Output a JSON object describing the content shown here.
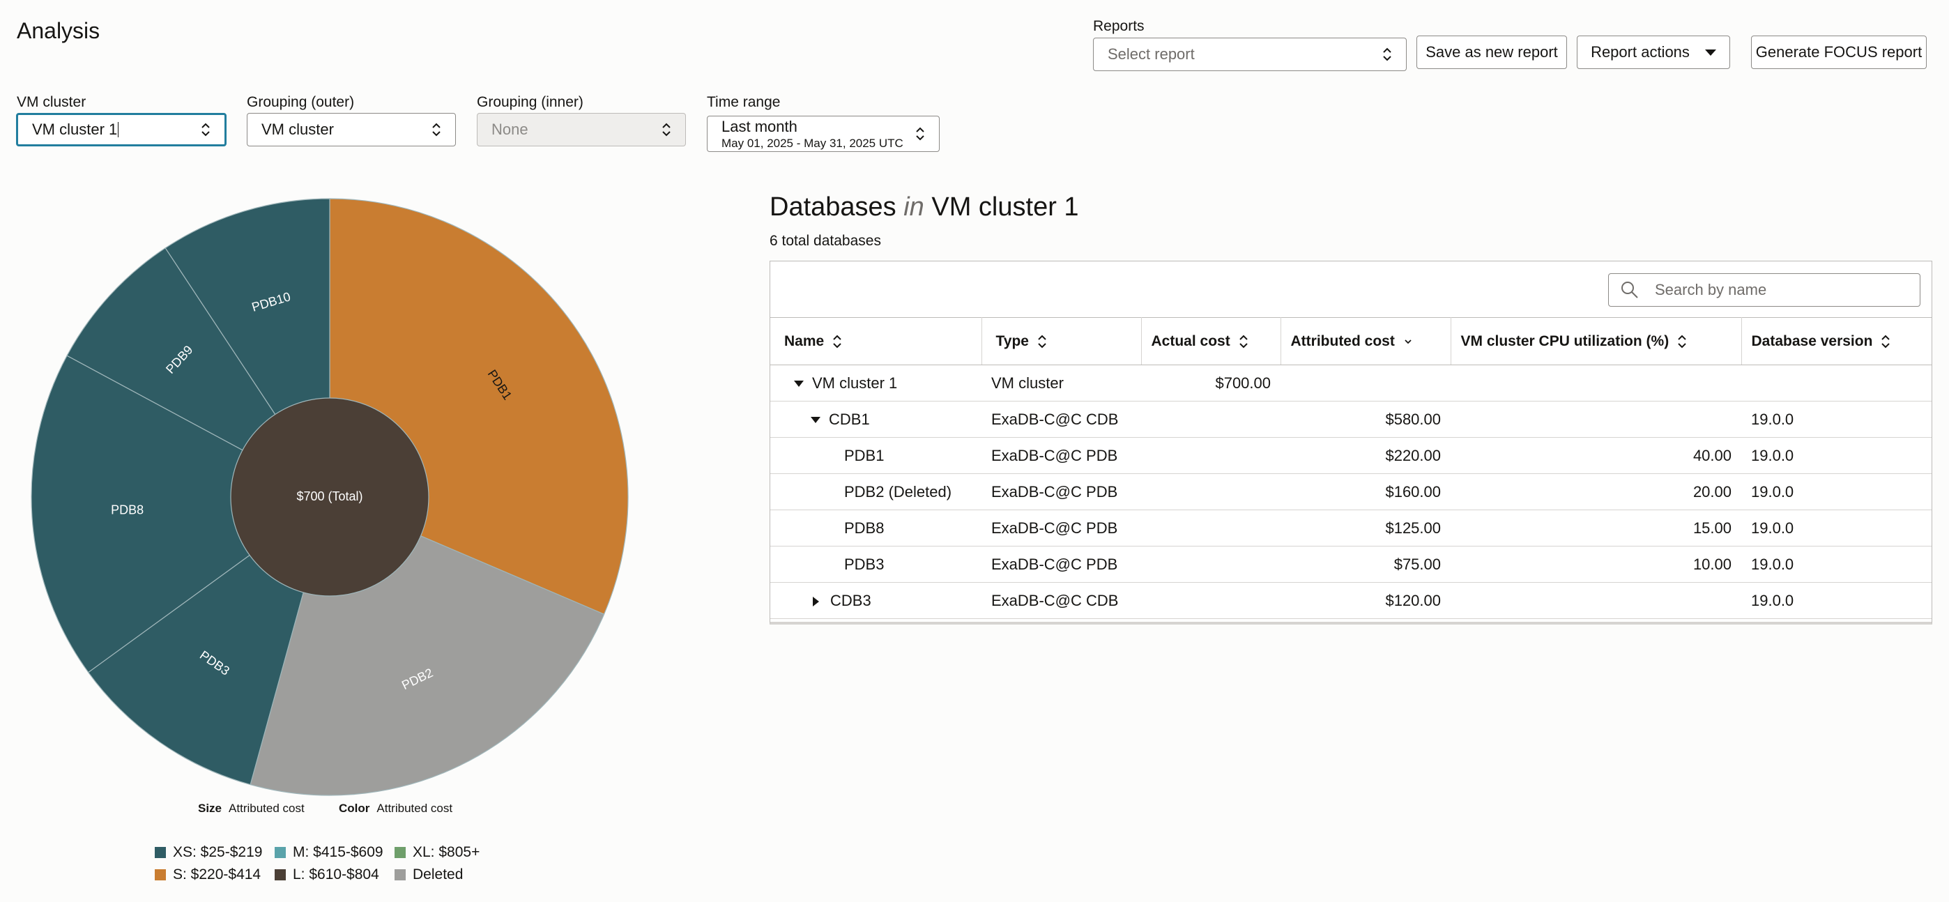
{
  "page": {
    "title": "Analysis"
  },
  "reports": {
    "label": "Reports",
    "select_placeholder": "Select report",
    "save_label": "Save as new report",
    "actions_label": "Report actions",
    "focus_label": "Generate FOCUS report"
  },
  "filters": {
    "vm_cluster": {
      "label": "VM cluster",
      "value": "VM cluster 1"
    },
    "grouping_outer": {
      "label": "Grouping (outer)",
      "value": "VM cluster"
    },
    "grouping_inner": {
      "label": "Grouping (inner)",
      "value": "None"
    },
    "time_range": {
      "label": "Time range",
      "value": "Last month",
      "sub": "May 01, 2025 - May 31, 2025 UTC"
    }
  },
  "chart_data": {
    "type": "pie",
    "center_label": "$700 (Total)",
    "slices": [
      {
        "label": "PDB1",
        "value": 220,
        "color": "#c97d31",
        "label_color": "#161513"
      },
      {
        "label": "PDB2",
        "value": 160,
        "color": "#9e9e9c",
        "label_color": "#ffffff"
      },
      {
        "label": "PDB3",
        "value": 75,
        "color": "#2f5c64",
        "label_color": "#ffffff"
      },
      {
        "label": "PDB8",
        "value": 125,
        "color": "#2f5c64",
        "label_color": "#ffffff"
      },
      {
        "label": "PDB9",
        "value": 55,
        "color": "#2f5c64",
        "label_color": "#ffffff"
      },
      {
        "label": "PDB10",
        "value": 65,
        "color": "#2f5c64",
        "label_color": "#ffffff"
      }
    ],
    "center_color": "#4b3f36",
    "size_caption": {
      "key": "Size",
      "value": "Attributed cost"
    },
    "color_caption": {
      "key": "Color",
      "value": "Attributed cost"
    },
    "legend": [
      {
        "label": "XS: $25-$219",
        "color": "#2f5c64"
      },
      {
        "label": "M: $415-$609",
        "color": "#5aa3aa"
      },
      {
        "label": "XL: $805+",
        "color": "#6f9f6b"
      },
      {
        "label": "S: $220-$414",
        "color": "#c97d31"
      },
      {
        "label": "L: $610-$804",
        "color": "#4b3f36"
      },
      {
        "label": "Deleted",
        "color": "#9e9e9c"
      }
    ]
  },
  "databases": {
    "heading_prefix": "Databases",
    "heading_in": "in",
    "heading_suffix": "VM cluster 1",
    "count": "6 total databases",
    "search_placeholder": "Search by name",
    "columns": [
      "Name",
      "Type",
      "Actual cost",
      "Attributed cost",
      "VM cluster CPU utilization (%)",
      "Database version"
    ],
    "rows": [
      {
        "name": "VM cluster 1",
        "type": "VM cluster",
        "actual": "$700.00",
        "attributed": "",
        "cpu": "",
        "version": ""
      },
      {
        "name": "CDB1",
        "type": "ExaDB-C@C CDB",
        "actual": "",
        "attributed": "$580.00",
        "cpu": "",
        "version": "19.0.0"
      },
      {
        "name": "PDB1",
        "type": "ExaDB-C@C PDB",
        "actual": "",
        "attributed": "$220.00",
        "cpu": "40.00",
        "version": "19.0.0"
      },
      {
        "name": "PDB2 (Deleted)",
        "type": "ExaDB-C@C PDB",
        "actual": "",
        "attributed": "$160.00",
        "cpu": "20.00",
        "version": "19.0.0"
      },
      {
        "name": "PDB8",
        "type": "ExaDB-C@C PDB",
        "actual": "",
        "attributed": "$125.00",
        "cpu": "15.00",
        "version": "19.0.0"
      },
      {
        "name": "PDB3",
        "type": "ExaDB-C@C PDB",
        "actual": "",
        "attributed": "$75.00",
        "cpu": "10.00",
        "version": "19.0.0"
      },
      {
        "name": "CDB3",
        "type": "ExaDB-C@C CDB",
        "actual": "",
        "attributed": "$120.00",
        "cpu": "",
        "version": "19.0.0"
      }
    ]
  }
}
